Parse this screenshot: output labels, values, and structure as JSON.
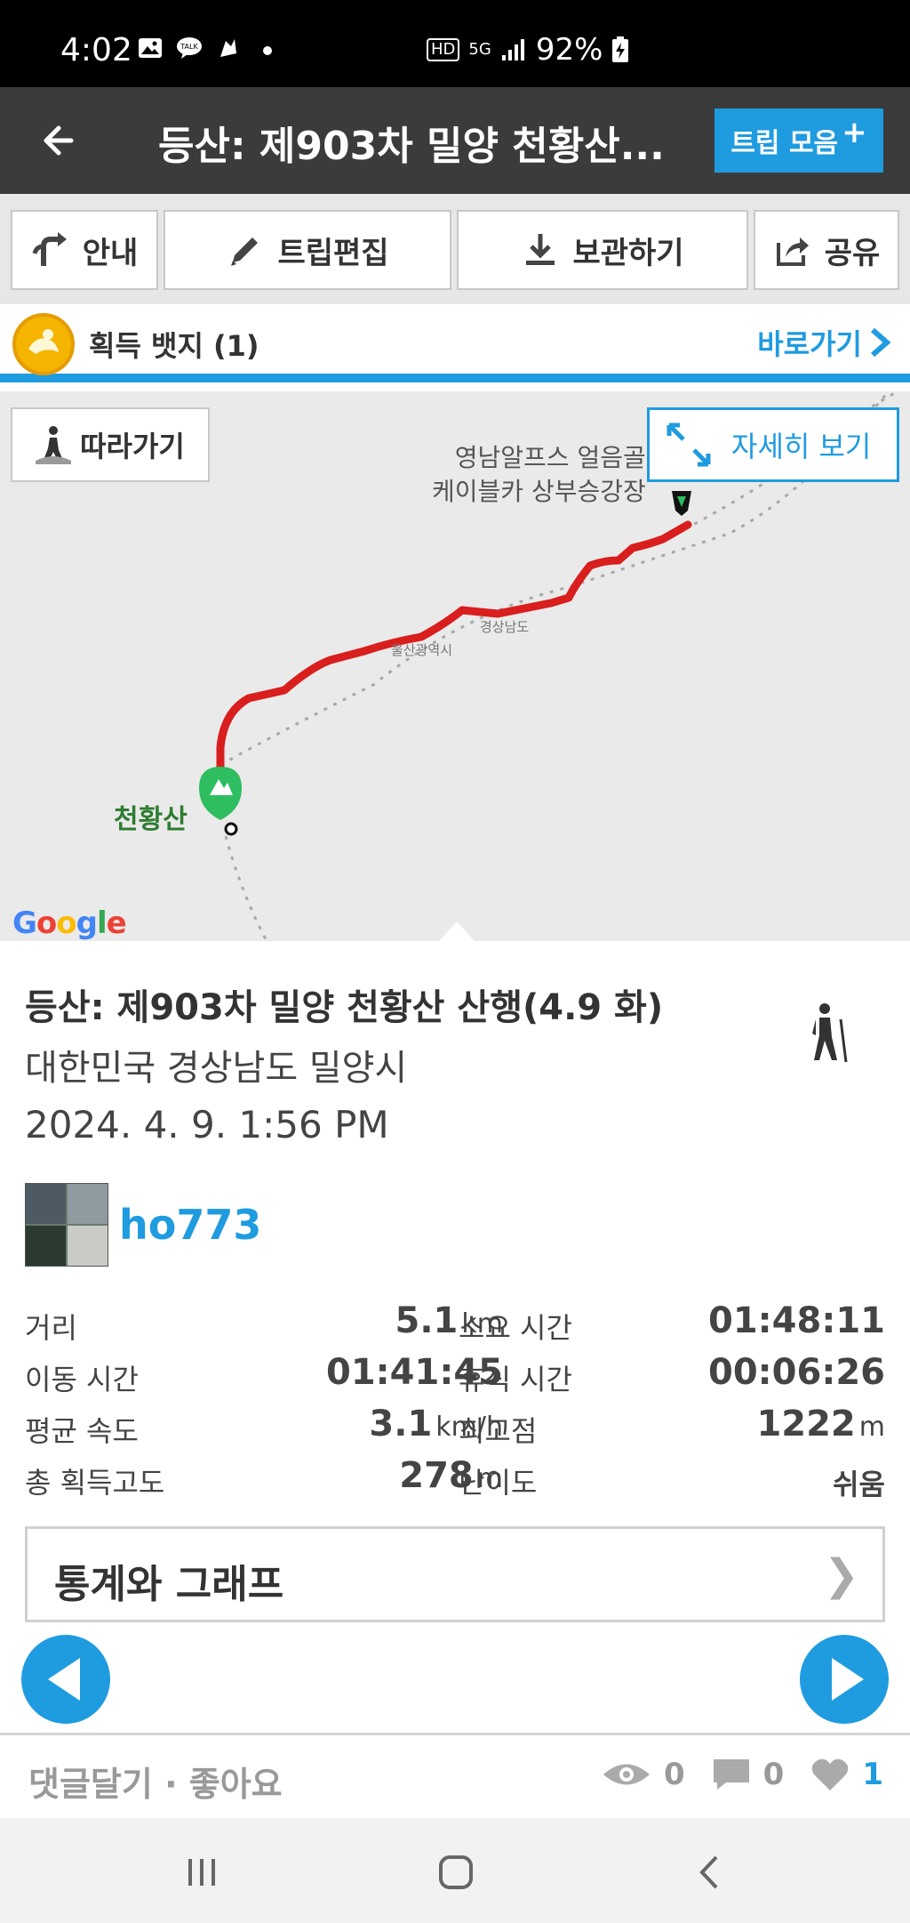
{
  "status_bar": {
    "time": "4:02",
    "hd_badge": "HD",
    "network": "5G",
    "battery": "92%",
    "icons": [
      "gallery-icon",
      "kakaotalk-icon",
      "app-icon",
      "dot-icon",
      "hd-icon",
      "5g-icon",
      "signal-icon",
      "battery-charging-icon"
    ]
  },
  "header": {
    "title": "등산: 제903차 밀양 천황산...",
    "trip_collection_label": "트립 모음",
    "trip_collection_plus": "+"
  },
  "toolbar": {
    "guide_label": "안내",
    "edit_label": "트립편집",
    "save_label": "보관하기",
    "share_label": "공유"
  },
  "badge": {
    "label": "획득 뱃지 (1)",
    "link_label": "바로가기"
  },
  "map": {
    "follow_label": "따라가기",
    "detail_label": "자세히 보기",
    "end_label_line1": "영남알프스 얼음골",
    "end_label_line2": "케이블카 상부승강장",
    "start_label": "천황산",
    "road_label_1": "울산광역시",
    "road_label_2": "경상남도",
    "attribution": "Google",
    "route_color": "#d91e1e"
  },
  "trip": {
    "title": "등산: 제903차 밀양 천황산 산행(4.9 화)",
    "region": "대한민국 경상남도 밀양시",
    "date": "2024. 4. 9. 1:56 PM",
    "username": "ho773",
    "activity_icon": "hiker-icon"
  },
  "stats": {
    "distance_label": "거리",
    "distance_value": "5.1",
    "distance_unit": "km",
    "duration_label": "소요 시간",
    "duration_value": "01:48:11",
    "moving_label": "이동 시간",
    "moving_value": "01:41:45",
    "rest_label": "휴식 시간",
    "rest_value": "00:06:26",
    "speed_label": "평균 속도",
    "speed_value": "3.1",
    "speed_unit": "km/h",
    "max_alt_label": "최고점",
    "max_alt_value": "1222",
    "max_alt_unit": "m",
    "gain_label": "총 획득고도",
    "gain_value": "278",
    "gain_unit": "m",
    "difficulty_label": "난이도",
    "difficulty_value": "쉬움"
  },
  "graph": {
    "label": "통계와 그래프",
    "chevron": "❯"
  },
  "footer": {
    "comment_like_label": "댓글달기 · 좋아요",
    "views": "0",
    "comments": "0",
    "likes": "1"
  },
  "colors": {
    "accent": "#1f9be0",
    "header_bg": "#3b3b3b",
    "route": "#d91e1e"
  }
}
